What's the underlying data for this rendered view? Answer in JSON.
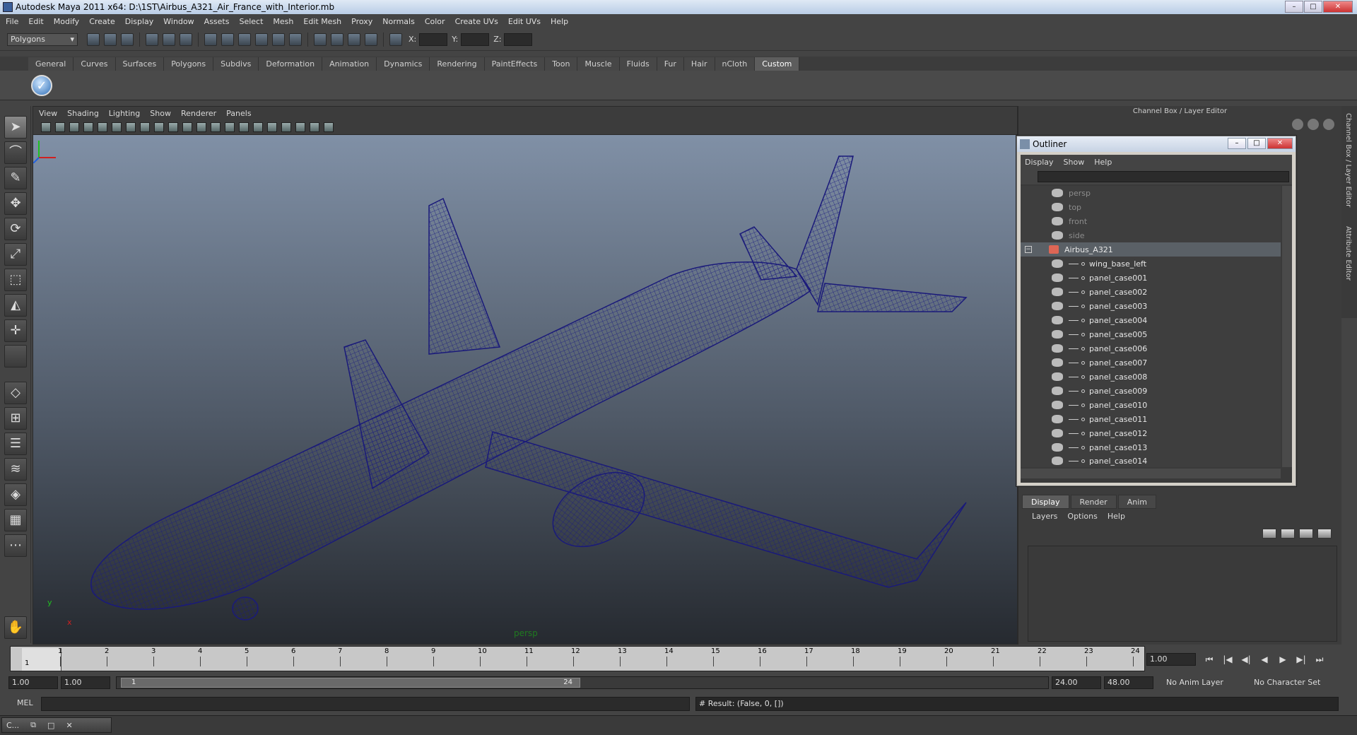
{
  "window": {
    "title": "Autodesk Maya 2011 x64: D:\\1ST\\Airbus_A321_Air_France_with_Interior.mb",
    "minimize": "–",
    "maximize": "□",
    "close": "✕"
  },
  "menubar": [
    "File",
    "Edit",
    "Modify",
    "Create",
    "Display",
    "Window",
    "Assets",
    "Select",
    "Mesh",
    "Edit Mesh",
    "Proxy",
    "Normals",
    "Color",
    "Create UVs",
    "Edit UVs",
    "Help"
  ],
  "status_line": {
    "mode": "Polygons",
    "coord_labels": [
      "X:",
      "Y:",
      "Z:"
    ]
  },
  "shelf": {
    "tabs": [
      "General",
      "Curves",
      "Surfaces",
      "Polygons",
      "Subdivs",
      "Deformation",
      "Animation",
      "Dynamics",
      "Rendering",
      "PaintEffects",
      "Toon",
      "Muscle",
      "Fluids",
      "Fur",
      "Hair",
      "nCloth",
      "Custom"
    ],
    "active_tab": "Custom",
    "custom_button_glyph": "✓"
  },
  "viewport": {
    "menu": [
      "View",
      "Shading",
      "Lighting",
      "Show",
      "Renderer",
      "Panels"
    ],
    "camera_label": "persp",
    "axis_y": "y",
    "axis_x": "x",
    "wire_color": "#1a1a7a"
  },
  "channel_box": {
    "title": "Channel Box / Layer Editor",
    "side_tab_1": "Channel Box / Layer Editor",
    "side_tab_2": "Attribute Editor"
  },
  "outliner": {
    "title": "Outliner",
    "menu": [
      "Display",
      "Show",
      "Help"
    ],
    "cameras": [
      "persp",
      "top",
      "front",
      "side"
    ],
    "root": "Airbus_A321",
    "children": [
      "wing_base_left",
      "panel_case001",
      "panel_case002",
      "panel_case003",
      "panel_case004",
      "panel_case005",
      "panel_case006",
      "panel_case007",
      "panel_case008",
      "panel_case009",
      "panel_case010",
      "panel_case011",
      "panel_case012",
      "panel_case013",
      "panel_case014"
    ]
  },
  "layer_editor": {
    "tabs": [
      "Display",
      "Render",
      "Anim"
    ],
    "active_tab": "Display",
    "menu": [
      "Layers",
      "Options",
      "Help"
    ]
  },
  "time_slider": {
    "ticks": [
      1,
      2,
      3,
      4,
      5,
      6,
      7,
      8,
      9,
      10,
      11,
      12,
      13,
      14,
      15,
      16,
      17,
      18,
      19,
      20,
      21,
      22,
      23,
      24
    ],
    "current_frame_marker": "1",
    "current_frame": "1.00",
    "playback_glyphs": [
      "⏮",
      "|◀",
      "◀|",
      "◀",
      "▶",
      "▶|",
      "⏭"
    ]
  },
  "range_slider": {
    "start": "1.00",
    "playback_start": "1.00",
    "handle_start": "1",
    "handle_end": "24",
    "playback_end": "24.00",
    "end": "48.00",
    "anim_layer": "No Anim Layer",
    "character_set": "No Character Set"
  },
  "command_line": {
    "label": "MEL",
    "result": "# Result: (False, 0, [])"
  },
  "taskbar": {
    "item": "C...",
    "restore": "⧉",
    "maximize": "□",
    "close": "✕"
  }
}
